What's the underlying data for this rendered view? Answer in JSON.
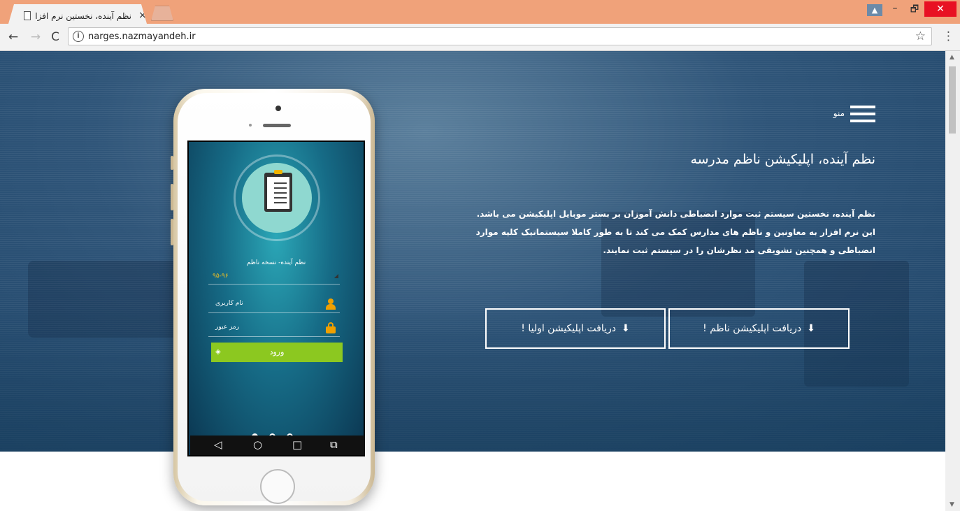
{
  "browser": {
    "tab_title": "نظم آینده، نخستین نرم افزا",
    "tab_close": "×",
    "url": "narges.nazmayandeh.ir",
    "nav": {
      "back": "←",
      "forward": "→",
      "reload": "C"
    },
    "info_icon": "i",
    "star": "☆",
    "menu": "⋮",
    "window": {
      "user": "▲",
      "minimize": "–",
      "maximize": "🗗",
      "close": "✕"
    }
  },
  "hero": {
    "menu_label": "منو",
    "title": "نظم آینده، اپلیکیشن ناظم مدرسه",
    "description": "نظم آینده، نخستین سیستم ثبت موارد انضباطی دانش آموزان بر بستر موبایل اپلیکیشن می باشد. این نرم افزار به معاونین و ناظم های مدارس کمک می کند تا به طور کاملا سیستماتیک کلیه موارد انضباطی و همچنین تشویقی مد نظرشان را در سیستم ثبت نمایند.",
    "buttons": {
      "nazem": "دریافت اپلیکیشن ناظم !",
      "olia": "دریافت اپلیکیشن اولیا !"
    },
    "download_icon": "⬇"
  },
  "phone_app": {
    "subtitle": "نظم آینده- نسخه ناظم",
    "year_select": "۹۵-۹۶",
    "select_arrow": "◢",
    "username_placeholder": "نام کاربری",
    "password_placeholder": "رمز عبور",
    "login_label": "ورود",
    "login_icon": "◈",
    "nav": {
      "back": "◁",
      "home": "○",
      "recent": "□",
      "extra": "⧉"
    }
  },
  "scrollbar": {
    "up": "▲",
    "down": "▼"
  }
}
